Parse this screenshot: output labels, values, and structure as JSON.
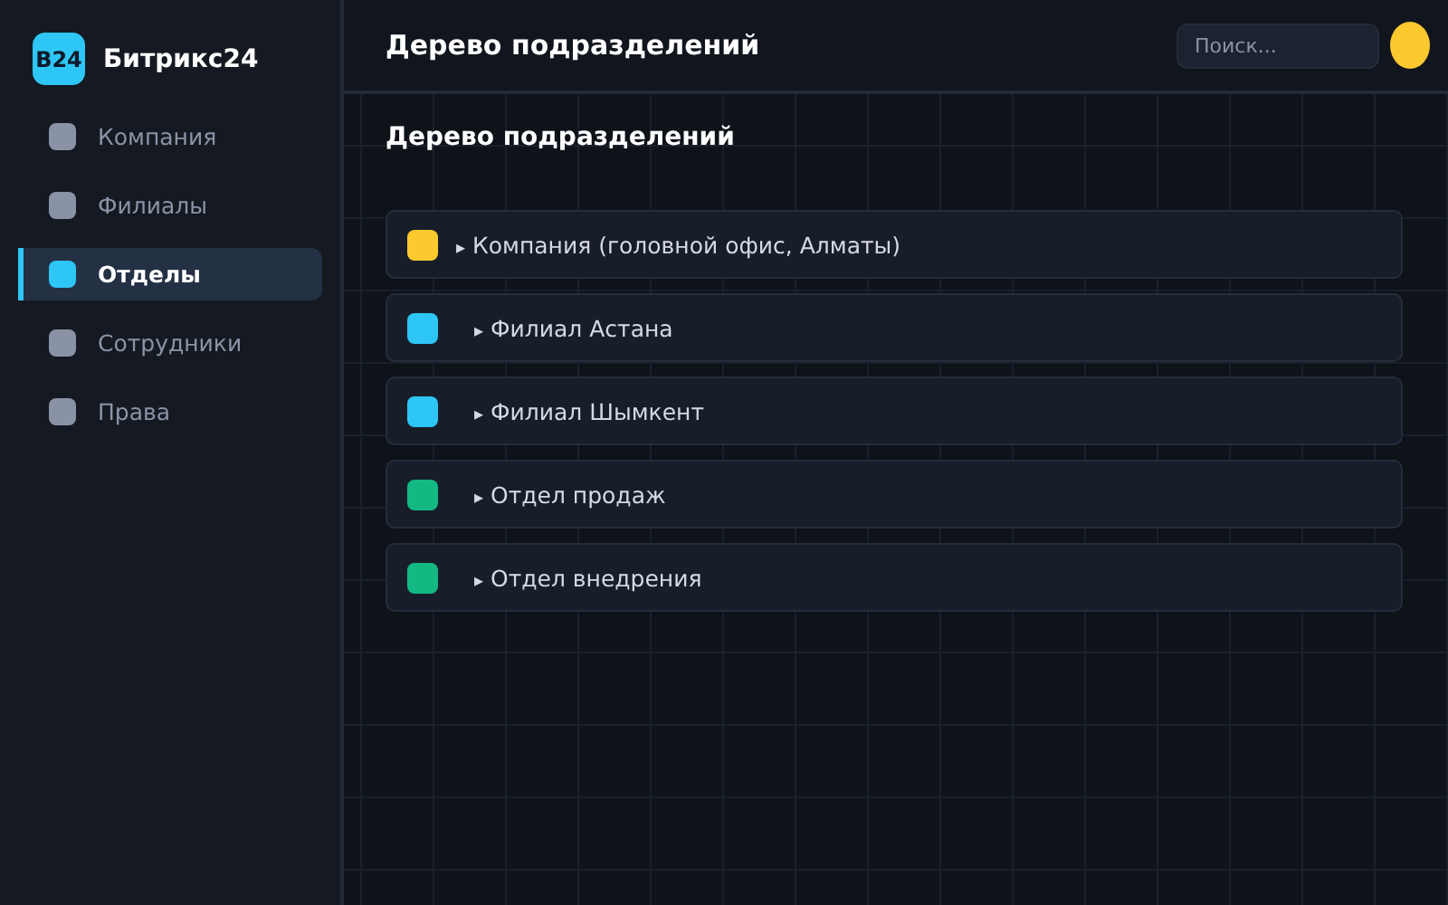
{
  "sidebar": {
    "logo": "B24",
    "brand": "Битрикс24",
    "items": [
      {
        "label": "Компания",
        "selected": false
      },
      {
        "label": "Филиалы",
        "selected": false
      },
      {
        "label": "Отделы",
        "selected": true
      },
      {
        "label": "Сотрудники",
        "selected": false
      },
      {
        "label": "Права",
        "selected": false
      }
    ]
  },
  "header": {
    "title": "Дерево подразделений",
    "search": {
      "placeholder": "Поиск..."
    }
  },
  "content": {
    "title": "Дерево подразделений",
    "tree": [
      {
        "arrow": "▸",
        "label": "Компания (головной офис, Алматы)",
        "color": "#fcc92f",
        "children": [
          {
            "arrow": "▸",
            "label": "Филиал Астана",
            "color": "#2ec6f5"
          },
          {
            "arrow": "▸",
            "label": "Филиал Шымкент",
            "color": "#2ec6f5"
          },
          {
            "arrow": "▸",
            "label": "Отдел продаж",
            "color": "#14b883"
          },
          {
            "arrow": "▸",
            "label": "Отдел внедрения",
            "color": "#14b883"
          }
        ]
      }
    ]
  }
}
